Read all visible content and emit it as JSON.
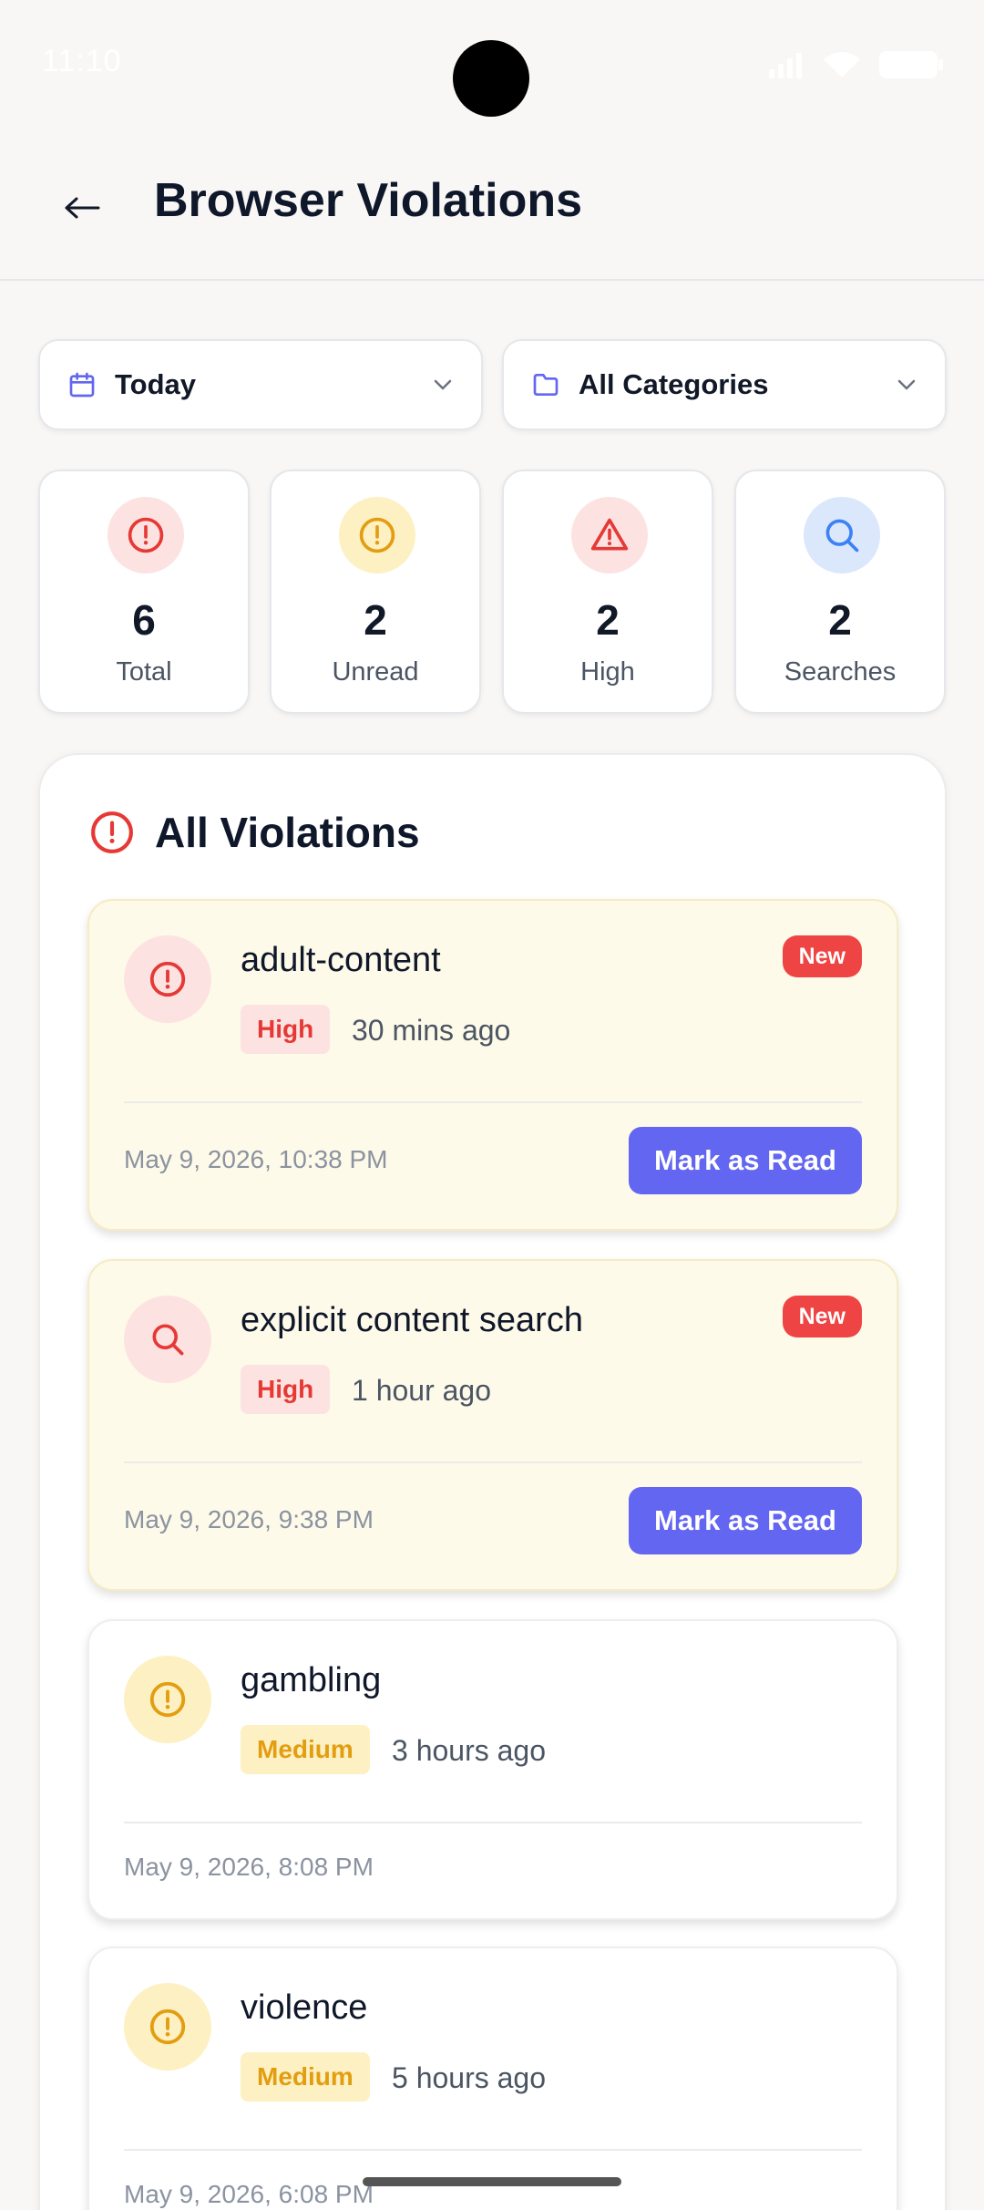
{
  "status_bar": {
    "time": "11:10"
  },
  "header": {
    "back_icon": "arrow-left-icon",
    "title": "Browser Violations"
  },
  "filters": {
    "date": {
      "icon": "calendar-icon",
      "value": "Today"
    },
    "category": {
      "icon": "folder-icon",
      "value": "All Categories"
    }
  },
  "stats": [
    {
      "icon": "alert-circle-icon",
      "value": "6",
      "label": "Total"
    },
    {
      "icon": "alert-circle-icon",
      "value": "2",
      "label": "Unread"
    },
    {
      "icon": "warning-triangle-icon",
      "value": "2",
      "label": "High"
    },
    {
      "icon": "search-icon",
      "value": "2",
      "label": "Searches"
    }
  ],
  "section": {
    "title": "All Violations"
  },
  "violations": [
    {
      "title": "adult-content",
      "severity": "High",
      "ago": "30 mins ago",
      "date": "May 9, 2026, 10:38 PM",
      "badge": "New",
      "action": "Mark as Read"
    },
    {
      "title": "explicit content search",
      "severity": "High",
      "ago": "1 hour ago",
      "date": "May 9, 2026, 9:38 PM",
      "badge": "New",
      "action": "Mark as Read"
    },
    {
      "title": "gambling",
      "severity": "Medium",
      "ago": "3 hours ago",
      "date": "May 9, 2026, 8:08 PM"
    },
    {
      "title": "violence",
      "severity": "Medium",
      "ago": "5 hours ago",
      "date": "May 9, 2026, 6:08 PM"
    }
  ],
  "colors": {
    "accent": "#6366f1",
    "danger": "#ef4444",
    "warning": "#f59e0b",
    "info": "#3b82f6",
    "unread_card_bg": "#fefae9"
  }
}
